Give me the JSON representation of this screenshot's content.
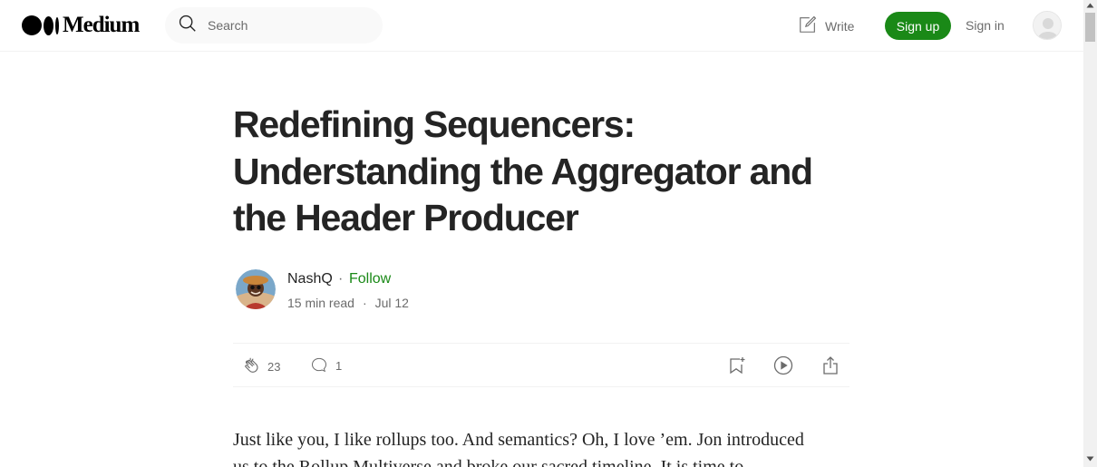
{
  "brand": {
    "name": "Medium"
  },
  "search": {
    "placeholder": "Search"
  },
  "nav": {
    "write_label": "Write",
    "signup_label": "Sign up",
    "signin_label": "Sign in"
  },
  "article": {
    "title_lines": [
      "Redefining Sequencers:",
      "Understanding the Aggregator and",
      "the Header Producer"
    ],
    "author": "NashQ",
    "separator": "·",
    "follow_label": "Follow",
    "read_time": "15 min read",
    "date": "Jul 12",
    "claps": "23",
    "responses": "1",
    "body_lines": [
      "Just like you, I like rollups too. And semantics? Oh, I love ’em. Jon introduced",
      "us to the Rollup Multiverse and broke our sacred timeline. It is time to"
    ]
  },
  "colors": {
    "accent": "#1a8917",
    "text": "#242424",
    "muted": "#6b6b6b"
  },
  "icons": [
    "search-icon",
    "write-icon",
    "user-avatar",
    "clap-icon",
    "comment-icon",
    "bookmark-add-icon",
    "play-icon",
    "share-icon"
  ]
}
